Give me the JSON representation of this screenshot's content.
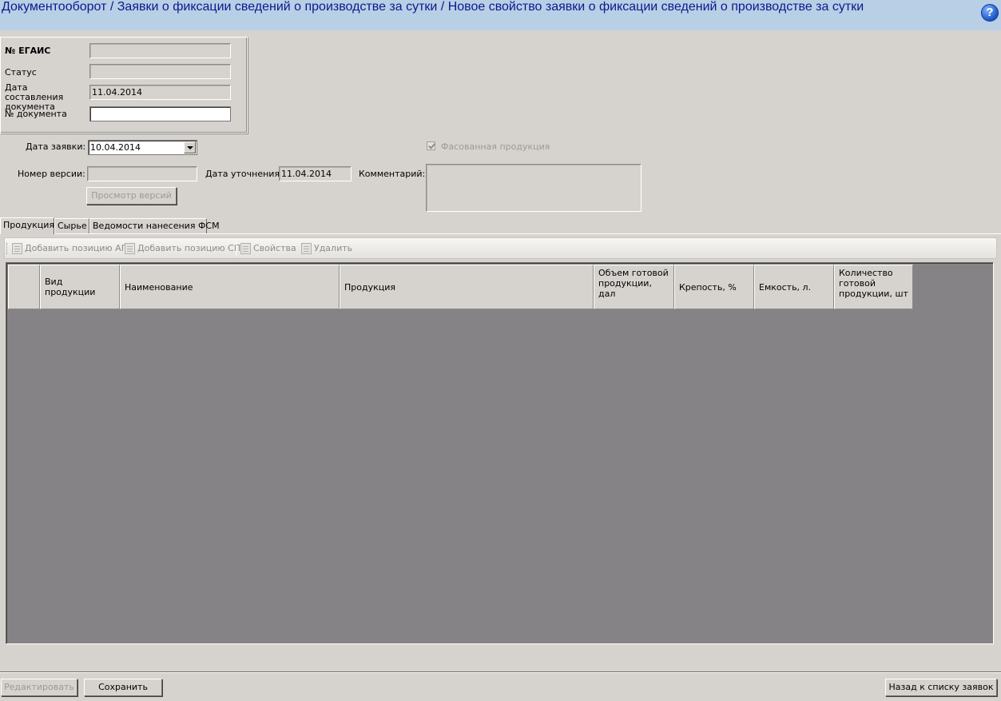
{
  "header": {
    "title": "Документооборот / Заявки о фиксации сведений о производстве за сутки / Новое свойство заявки о фиксации сведений о производстве за сутки",
    "help_label": "?"
  },
  "doc_group": {
    "egais_label": "№ ЕГАИС",
    "egais_value": "",
    "status_label": "Статус",
    "status_value": "",
    "date_label": "Дата составления документа",
    "date_value": "11.04.2014",
    "docnum_label": "№ документа",
    "docnum_value": ""
  },
  "request": {
    "date_label": "Дата заявки:",
    "date_value": "10.04.2014",
    "version_label": "Номер версии:",
    "version_value": "",
    "clarify_label": "Дата уточнения:",
    "clarify_value": "11.04.2014",
    "view_versions_button": "Просмотр версий",
    "packaged_label": "Фасованная продукция",
    "packaged_checked": true,
    "comment_label": "Комментарий:",
    "comment_value": ""
  },
  "tabs": [
    {
      "label": "Продукция",
      "active": true
    },
    {
      "label": "Сырье",
      "active": false
    },
    {
      "label": "Ведомости нанесения ФСМ",
      "active": false
    }
  ],
  "toolbar": {
    "add_ap": "Добавить позицию АП",
    "add_sp": "Добавить позицию СП",
    "properties": "Свойства",
    "delete": "Удалить"
  },
  "grid": {
    "columns": [
      "",
      "Вид продукции",
      "Наименование",
      "Продукция",
      "Объем готовой продукции, дал",
      "Крепость, %",
      "Емкость, л.",
      "Количество готовой продукции, шт"
    ],
    "rows": []
  },
  "footer": {
    "edit_button": "Редактировать",
    "save_button": "Сохранить",
    "back_button": "Назад к списку заявок"
  }
}
